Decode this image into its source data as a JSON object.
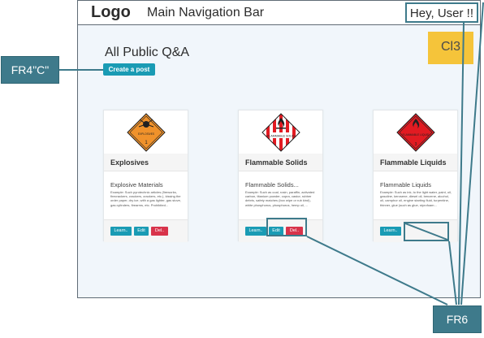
{
  "navbar": {
    "logo": "Logo",
    "title": "Main Navigation Bar",
    "user_greeting": "Hey, User !!"
  },
  "main": {
    "heading": "All Public Q&A",
    "create_button": "Create a post"
  },
  "cards": [
    {
      "title": "Explosives",
      "subtitle": "Explosive Materials",
      "description": "Example: Such pyrotechnic articles (fireworks, firecrackers, crackers, crackers, etc.), kissing the order paper, dry ice, with a gas lighter, gas stove, gas cylinders, firearms, etc. Prohibited...",
      "label_on_sign": "EXPLOSIVES",
      "buttons": {
        "learn": "Learn..",
        "edit": "Edit",
        "delete": "Del.."
      }
    },
    {
      "title": "Flammable Solids",
      "subtitle": "Flammable Solids...",
      "description": "Example: Such as coal, rosin, paraffin, activated carbon, titanium powder, copra, castor, rubber debris, safety matches (box wipe or rub kind), white phosphorus, phosphorus, hemp oil, ...",
      "label_on_sign": "FLAMMABLE SOLID",
      "buttons": {
        "learn": "Learn..",
        "edit": "Edit",
        "delete": "Del.."
      }
    },
    {
      "title": "Flammable Liquids",
      "subtitle": "Flammable Liquids",
      "description": "Example: Such as ink, to the light water, paint, oil, gasoline, kerosene, diesel oil, benzene, alcohol, oil, camphor oil, engine starting fluid, turpentine, thinner, glue (such as glue, styrofoam...",
      "label_on_sign": "FLAMMABLE LIQUID",
      "buttons": {
        "learn": "Learn.."
      }
    }
  ],
  "annotations": {
    "fr4": "FR4\"C\"",
    "cl3": "Cl3",
    "fr6": "FR6"
  },
  "colors": {
    "accent": "#1a9bb4",
    "danger": "#d8334a",
    "annotation": "#3e7a8b",
    "sticky_note": "#f5c43a",
    "explosive_sign": "#f0922b",
    "flammable_sign": "#e21b22"
  }
}
